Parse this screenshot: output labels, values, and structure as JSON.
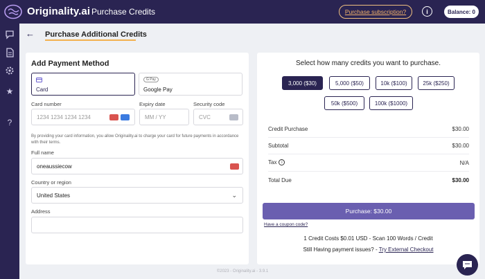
{
  "app": {
    "brand": "Originality.ai",
    "page_heading": "Purchase Credits"
  },
  "topbar": {
    "subscription_link": "Purchase subscription?",
    "info_icon": "info-icon",
    "balance": "Balance: 0"
  },
  "sidebar": {
    "icons": [
      "chat-scan-icon",
      "document-icon",
      "settings-gear-icon",
      "star-icon",
      "help-question-icon"
    ]
  },
  "header": {
    "title": "Purchase Additional Credits"
  },
  "payment": {
    "heading": "Add Payment Method",
    "tabs": [
      {
        "label": "Card",
        "icon": "credit-card-icon",
        "selected": true
      },
      {
        "label": "Google Pay",
        "icon": "gpay-badge",
        "badge": "G Pay",
        "selected": false
      }
    ],
    "card_number_label": "Card number",
    "card_number_placeholder": "1234 1234 1234 1234",
    "expiry_label": "Expiry date",
    "expiry_placeholder": "MM / YY",
    "security_label": "Security code",
    "security_placeholder": "CVC",
    "notice": "By providing your card information, you allow Originality.ai to charge your card for future payments in accordance with their terms.",
    "full_name_label": "Full name",
    "full_name_value": "oneaussiecow",
    "country_label": "Country or region",
    "country_value": "United States",
    "address_label": "Address",
    "address_value": ""
  },
  "purchase": {
    "heading": "Select how many credits you want to purchase.",
    "options": [
      {
        "label": "3,000 ($30)",
        "selected": true
      },
      {
        "label": "5,000 ($50)",
        "selected": false
      },
      {
        "label": "10k ($100)",
        "selected": false
      },
      {
        "label": "25k ($250)",
        "selected": false
      },
      {
        "label": "50k ($500)",
        "selected": false
      },
      {
        "label": "100k ($1000)",
        "selected": false
      }
    ],
    "rows": [
      {
        "label": "Credit Purchase",
        "value": "$30.00"
      },
      {
        "label": "Subtotal",
        "value": "$30.00"
      },
      {
        "label": "Tax",
        "value": "N/A"
      },
      {
        "label": "Total Due",
        "value": "$30.00"
      }
    ],
    "button_label": "Purchase: $30.00",
    "coupon_link": "Have a coupon code?",
    "credit_cost": "1 Credit Costs $0.01 USD - Scan 100 Words / Credit",
    "issues_text": "Still Having payment issues? - ",
    "issues_link": "Try External Checkout"
  },
  "footer": {
    "text": "©2023 - Originality.ai - 3.9.1"
  },
  "colors": {
    "navy": "#2a2452",
    "accent_orange": "#f2b04d",
    "button_purple": "#6a5fb0"
  }
}
